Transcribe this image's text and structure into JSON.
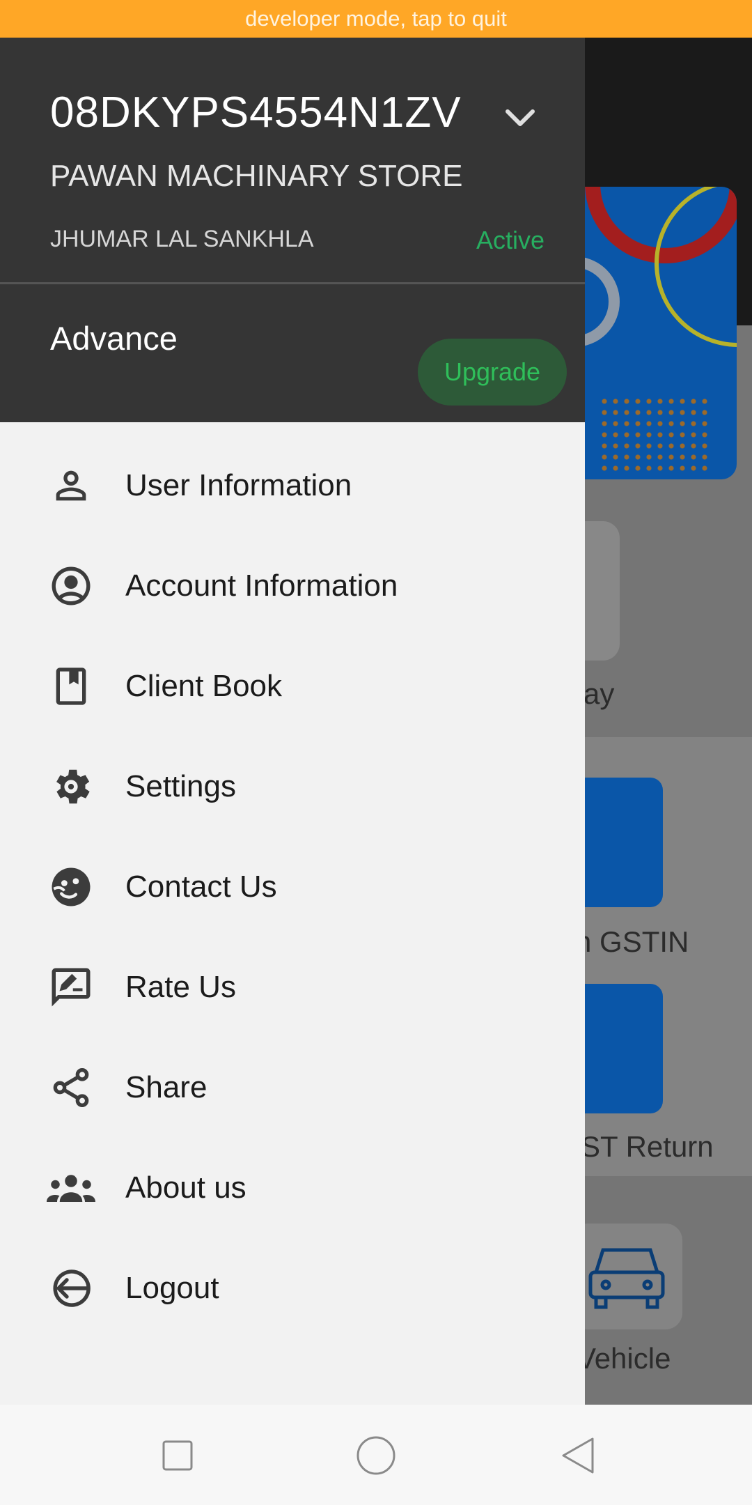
{
  "dev_banner": {
    "text": "developer mode, tap to quit"
  },
  "drawer": {
    "gstin": "08DKYPS4554N1ZV",
    "store_name": "PAWAN MACHINARY STORE",
    "owner_name": "JHUMAR LAL SANKHLA",
    "status": "Active",
    "plan": "Advance",
    "upgrade_label": "Upgrade",
    "menu": [
      {
        "label": "User Information",
        "icon": "person-icon"
      },
      {
        "label": "Account Information",
        "icon": "account-circle-icon"
      },
      {
        "label": "Client Book",
        "icon": "book-icon"
      },
      {
        "label": "Settings",
        "icon": "gear-icon"
      },
      {
        "label": "Contact Us",
        "icon": "support-face-icon"
      },
      {
        "label": "Rate Us",
        "icon": "rate-review-icon"
      },
      {
        "label": "Share",
        "icon": "share-icon"
      },
      {
        "label": "About us",
        "icon": "group-icon"
      },
      {
        "label": "Logout",
        "icon": "logout-icon"
      }
    ]
  },
  "background": {
    "partial_labels": [
      "ay",
      "n GSTIN",
      "ST Return",
      "Vehicle"
    ]
  },
  "colors": {
    "banner": "#ffa726",
    "drawer_header": "#353535",
    "active": "#27ae60",
    "tile_blue": "#0a56a8"
  }
}
